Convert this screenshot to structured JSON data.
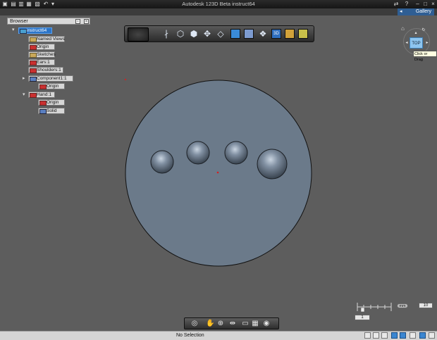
{
  "window": {
    "title": "Autodesk 123D Beta  instruct64",
    "help_label": "?"
  },
  "gallery": {
    "label": "Gallery"
  },
  "browser": {
    "title": "Browser",
    "tree": [
      {
        "label": "instruct64",
        "icon": "component-icon",
        "selected": true
      },
      {
        "label": "Named Views",
        "icon": "folder-icon"
      },
      {
        "label": "Origin",
        "icon": "hidden-icon"
      },
      {
        "label": "Sketches",
        "icon": "folder-icon"
      },
      {
        "label": "Ears:1",
        "icon": "hidden-icon"
      },
      {
        "label": "Shoulders:1",
        "icon": "hidden-icon"
      },
      {
        "label": "Component1:1",
        "icon": "visible-icon"
      },
      {
        "label": "Origin",
        "icon": "hidden-icon"
      },
      {
        "label": "Hand:1",
        "icon": "hidden-icon"
      },
      {
        "label": "Origin",
        "icon": "hidden-icon"
      },
      {
        "label": "Solid",
        "icon": "visible-icon"
      }
    ]
  },
  "viewcube": {
    "face_label": "TOP",
    "tooltip": "Click or Drag"
  },
  "ruler": {
    "left_value": "1",
    "right_value": "10",
    "unit": "mm"
  },
  "status": {
    "text": "No Selection"
  },
  "colors": {
    "accent": "#2b74c7",
    "viewport": "#5d5d5d",
    "model": "#6b7a8a"
  }
}
